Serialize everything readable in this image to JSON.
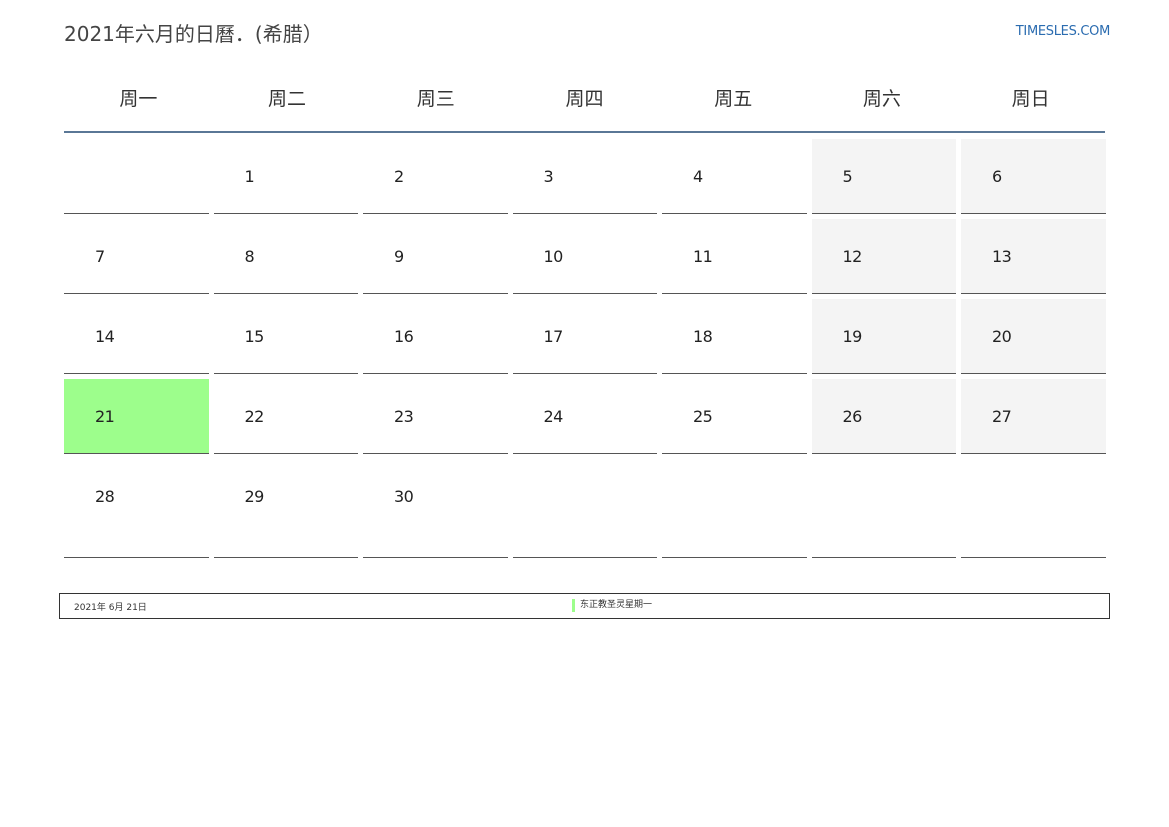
{
  "title": "2021年六月的日曆．(希腊）",
  "site_link": "TIMESLES.COM",
  "weekdays": [
    "周一",
    "周二",
    "周三",
    "周四",
    "周五",
    "周六",
    "周日"
  ],
  "weeks": [
    [
      "",
      "1",
      "2",
      "3",
      "4",
      "5",
      "6"
    ],
    [
      "7",
      "8",
      "9",
      "10",
      "11",
      "12",
      "13"
    ],
    [
      "14",
      "15",
      "16",
      "17",
      "18",
      "19",
      "20"
    ],
    [
      "21",
      "22",
      "23",
      "24",
      "25",
      "26",
      "27"
    ],
    [
      "28",
      "29",
      "30",
      "",
      "",
      "",
      ""
    ]
  ],
  "highlighted_day": "21",
  "colors": {
    "highlight": "#9dfe8c",
    "weekend_bg": "#f4f4f4",
    "header_rule": "#5a7796",
    "link": "#2b6cb0"
  },
  "footer": {
    "date": "2021年 6月 21日",
    "event": "东正教圣灵星期一"
  }
}
